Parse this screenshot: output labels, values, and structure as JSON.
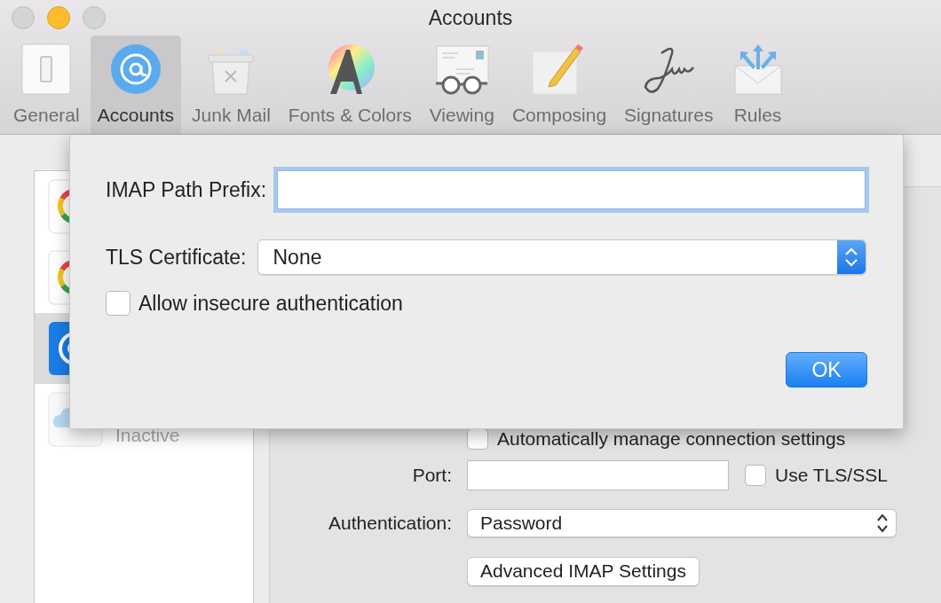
{
  "window": {
    "title": "Accounts"
  },
  "toolbar": [
    {
      "label": "General",
      "selected": false
    },
    {
      "label": "Accounts",
      "selected": true
    },
    {
      "label": "Junk Mail",
      "selected": false
    },
    {
      "label": "Fonts & Colors",
      "selected": false
    },
    {
      "label": "Viewing",
      "selected": false
    },
    {
      "label": "Composing",
      "selected": false
    },
    {
      "label": "Signatures",
      "selected": false
    },
    {
      "label": "Rules",
      "selected": false
    }
  ],
  "accounts": [
    {
      "kind": "google",
      "selected": false
    },
    {
      "kind": "google",
      "selected": false
    },
    {
      "kind": "imap",
      "selected": true
    },
    {
      "kind": "cloud",
      "selected": false,
      "status": "Inactive"
    }
  ],
  "server_settings": {
    "auto_manage": {
      "label": "Automatically manage connection settings",
      "checked": false
    },
    "port": {
      "label": "Port:"
    },
    "use_tls": {
      "label": "Use TLS/SSL",
      "checked": false
    },
    "authentication": {
      "label": "Authentication:",
      "value": "Password"
    },
    "advanced_button": "Advanced IMAP Settings"
  },
  "sheet": {
    "path_prefix": {
      "label": "IMAP Path Prefix:",
      "focused": true
    },
    "tls_certificate": {
      "label": "TLS Certificate:",
      "value": "None"
    },
    "allow_insecure": {
      "label": "Allow insecure authentication",
      "checked": false
    },
    "ok_button": "OK"
  }
}
